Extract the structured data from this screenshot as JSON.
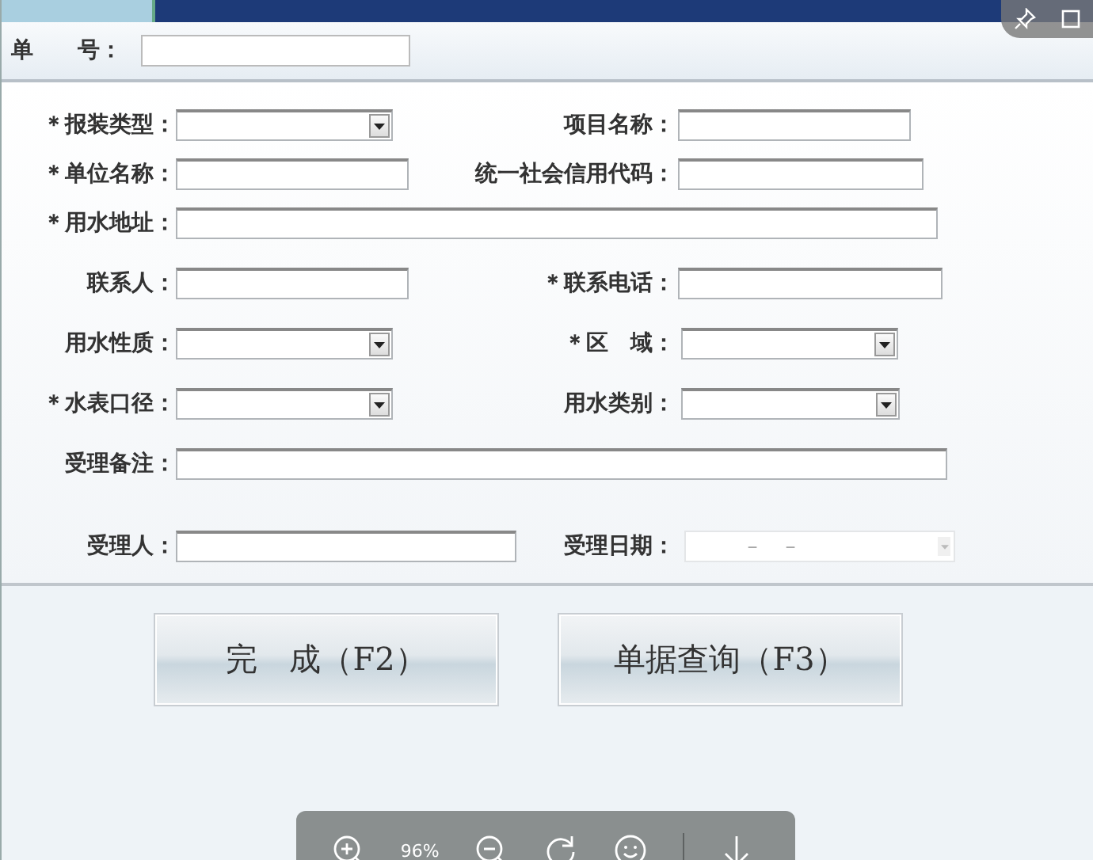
{
  "header": {
    "label": "单　　号："
  },
  "form_rows": [
    {
      "left": {
        "label": "＊报装类型：",
        "kind": "select"
      },
      "right": {
        "label": "项目名称：",
        "kind": "text"
      }
    },
    {
      "left": {
        "label": "＊单位名称：",
        "kind": "text"
      },
      "right": {
        "label": "统一社会信用代码：",
        "kind": "text"
      }
    },
    {
      "left": {
        "label": "＊用水地址：",
        "kind": "text"
      }
    },
    {
      "left": {
        "label": "联系人：",
        "kind": "text"
      },
      "right": {
        "label": "＊联系电话：",
        "kind": "text"
      }
    },
    {
      "left": {
        "label": "用水性质：",
        "kind": "select"
      },
      "right": {
        "label": "＊区　域：",
        "kind": "select"
      }
    },
    {
      "left": {
        "label": "＊水表口径：",
        "kind": "select"
      },
      "right": {
        "label": "用水类别：",
        "kind": "select"
      }
    },
    {
      "left": {
        "label": "受理备注：",
        "kind": "text"
      }
    },
    {
      "left": {
        "label": "受理人：",
        "kind": "text"
      },
      "right": {
        "label": "受理日期：",
        "kind": "date",
        "value": "－　－",
        "disabled": true
      }
    }
  ],
  "buttons": [
    "完　成（F2）",
    "单据查询（F3）"
  ],
  "viewer_toolbar": {
    "zoom": "96%"
  }
}
